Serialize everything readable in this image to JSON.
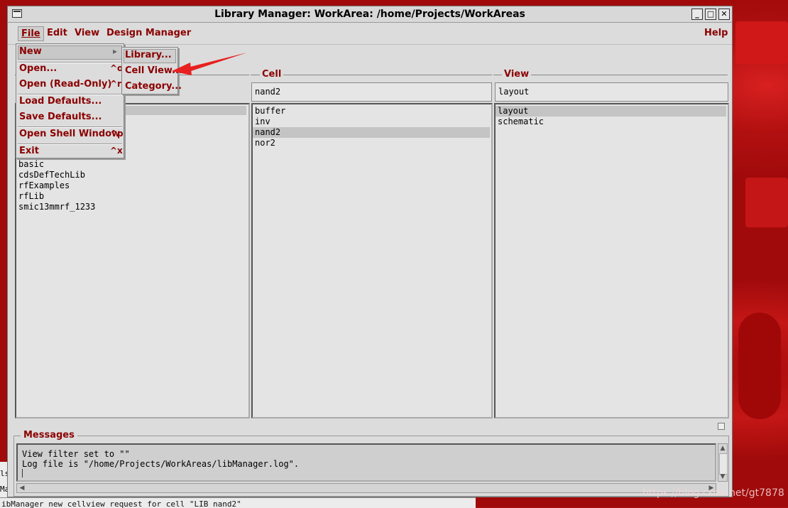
{
  "window": {
    "title": "Library Manager: WorkArea: /home/Projects/WorkAreas",
    "minimize_label": "_",
    "maximize_label": "□",
    "close_label": "✕"
  },
  "menubar": {
    "file": "File",
    "edit": "Edit",
    "view": "View",
    "design_manager": "Design Manager",
    "help": "Help"
  },
  "file_menu": {
    "new": "New",
    "new_arrow": "▸",
    "open": "Open...",
    "open_shortcut": "^o",
    "open_readonly": "Open (Read-Only)",
    "open_readonly_shortcut": "^r",
    "load_defaults": "Load Defaults...",
    "save_defaults": "Save Defaults...",
    "open_shell": "Open Shell Window",
    "open_shell_shortcut": "^p",
    "exit": "Exit",
    "exit_shortcut": "^x"
  },
  "new_submenu": {
    "library": "Library...",
    "cell_view": "Cell View...",
    "category": "Category..."
  },
  "columns": {
    "cell": {
      "label": "Cell",
      "filter": "nand2"
    },
    "view": {
      "label": "View",
      "filter": "layout"
    }
  },
  "library_list": [
    "basic",
    "cdsDefTechLib",
    "rfExamples",
    "rfLib",
    "smic13mmrf_1233"
  ],
  "cell_list": [
    {
      "name": "buffer",
      "selected": false
    },
    {
      "name": "inv",
      "selected": false
    },
    {
      "name": "nand2",
      "selected": true
    },
    {
      "name": "nor2",
      "selected": false
    }
  ],
  "view_list": [
    {
      "name": "layout",
      "selected": true
    },
    {
      "name": "schematic",
      "selected": false
    }
  ],
  "messages": {
    "title": "Messages",
    "lines": [
      "View filter set to \"\"",
      "Log file is \"/home/Projects/WorkAreas/libManager.log\"."
    ]
  },
  "background_terminal": {
    "line": "ibManager new cellview request for cell \"LIB nand2\"",
    "left_top": "ls",
    "left_bottom": "Ma"
  },
  "watermark": "https://blog.csdn.net/gt7878",
  "colors": {
    "menu_text": "#8b0000",
    "desktop": "#b01010",
    "annotation_arrow": "#e82020"
  }
}
